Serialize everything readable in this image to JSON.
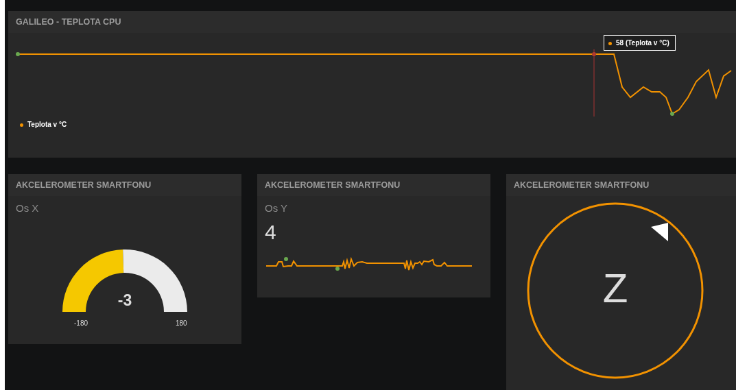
{
  "top_panel": {
    "title": "GALILEO - TEPLOTA CPU",
    "tooltip": "58 (Teplota v °C)",
    "legend": "Teplota v °C"
  },
  "panels": [
    {
      "kind": "gauge",
      "title": "AKCELEROMETER SMARTFONU",
      "label": "Os X",
      "value": "-3",
      "min": "-180",
      "max": "180"
    },
    {
      "kind": "sparkline",
      "title": "AKCELEROMETER SMARTFONU",
      "label": "Os Y",
      "value": "4"
    },
    {
      "kind": "compass",
      "title": "AKCELEROMETER SMARTFONU",
      "letter": "Z"
    }
  ]
}
